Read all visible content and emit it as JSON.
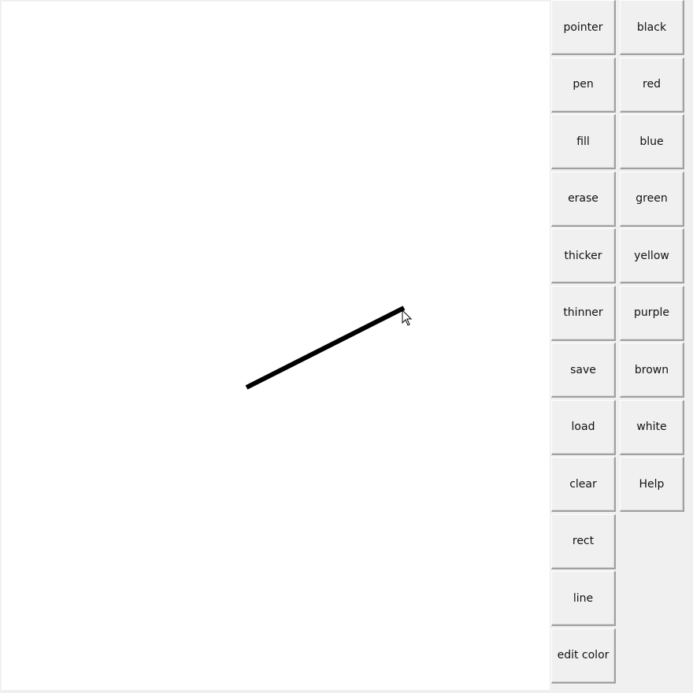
{
  "tools": [
    {
      "label": "pointer"
    },
    {
      "label": "pen"
    },
    {
      "label": "fill"
    },
    {
      "label": "erase"
    },
    {
      "label": "thicker"
    },
    {
      "label": "thinner"
    },
    {
      "label": "save"
    },
    {
      "label": "load"
    },
    {
      "label": "clear"
    },
    {
      "label": "rect"
    },
    {
      "label": "line"
    },
    {
      "label": "edit color"
    }
  ],
  "colors": [
    {
      "label": "black"
    },
    {
      "label": "red"
    },
    {
      "label": "blue"
    },
    {
      "label": "green"
    },
    {
      "label": "yellow"
    },
    {
      "label": "purple"
    },
    {
      "label": "brown"
    },
    {
      "label": "white"
    },
    {
      "label": "Help"
    }
  ],
  "drawing": {
    "stroke_color": "#000000",
    "icons": [
      "arrow-pointer-cursor"
    ]
  }
}
